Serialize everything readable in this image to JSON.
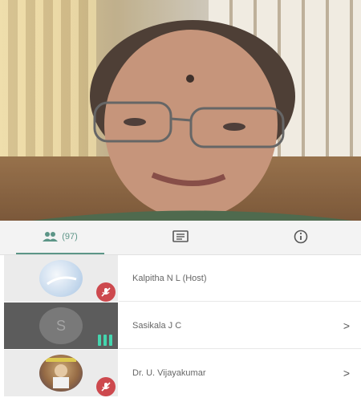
{
  "tabs": {
    "participants": {
      "icon": "people-icon",
      "count": "(97)"
    },
    "chat": {
      "icon": "chat-icon"
    },
    "info": {
      "icon": "info-icon"
    }
  },
  "participants": [
    {
      "name": "Kalpitha N L (Host)",
      "mic": "muted",
      "avatar": "photo-icon",
      "chevron": ""
    },
    {
      "name": "Sasikala J C",
      "mic": "speaking",
      "avatar_letter": "S",
      "chevron": ">"
    },
    {
      "name": "Dr. U. Vijayakumar",
      "mic": "muted",
      "avatar": "photo-icon",
      "chevron": ">"
    }
  ],
  "colors": {
    "accent": "#4a8a7a",
    "muted": "#c8353a",
    "speaking": "#2fd1a5"
  }
}
